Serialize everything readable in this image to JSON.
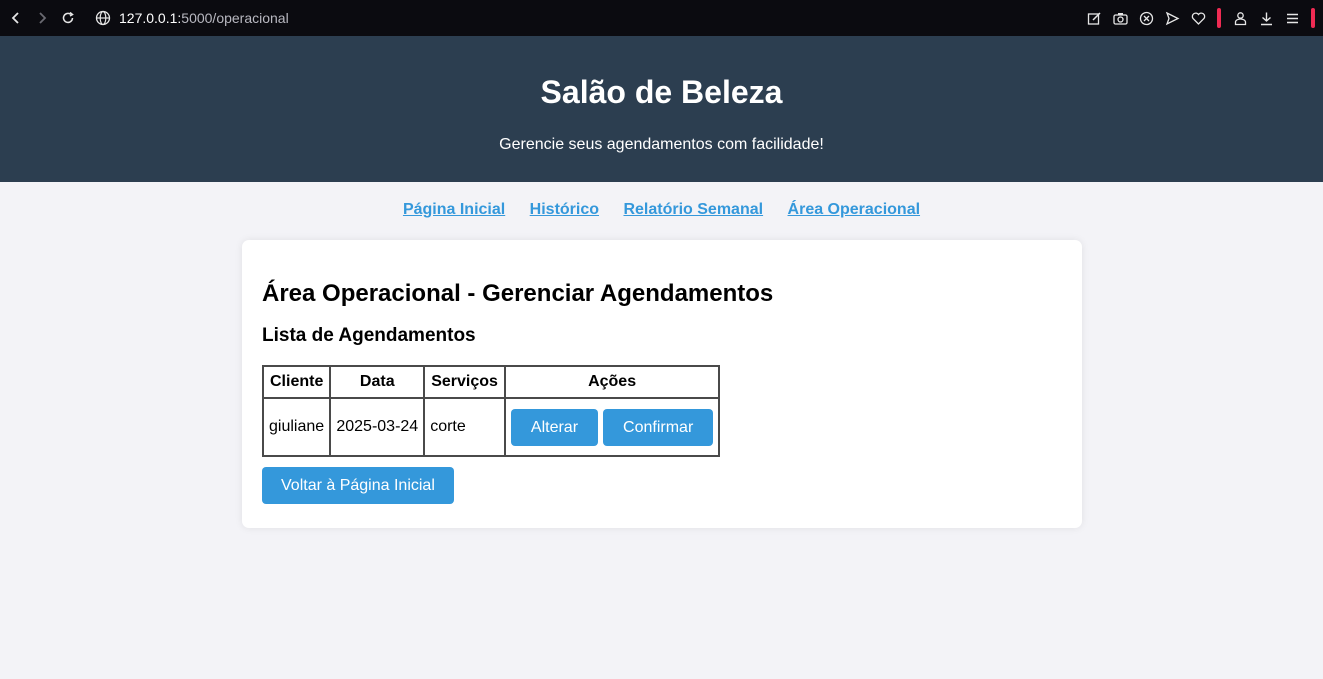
{
  "browser": {
    "url_host": "127.0.0.1:",
    "url_path": "5000/operacional"
  },
  "header": {
    "title": "Salão de Beleza",
    "subtitle": "Gerencie seus agendamentos com facilidade!"
  },
  "nav": {
    "items": [
      "Página Inicial",
      "Histórico",
      "Relatório Semanal",
      "Área Operacional"
    ]
  },
  "main": {
    "title": "Área Operacional - Gerenciar Agendamentos",
    "list_title": "Lista de Agendamentos",
    "table": {
      "headers": [
        "Cliente",
        "Data",
        "Serviços",
        "Ações"
      ],
      "rows": [
        {
          "cliente": "giuliane",
          "data": "2025-03-24",
          "servicos": "corte",
          "alterar": "Alterar",
          "confirmar": "Confirmar"
        }
      ]
    },
    "back_button": "Voltar à Página Inicial"
  },
  "colors": {
    "header_bg": "#2c3e50",
    "accent": "#3498db",
    "page_bg": "#f3f3f7"
  }
}
